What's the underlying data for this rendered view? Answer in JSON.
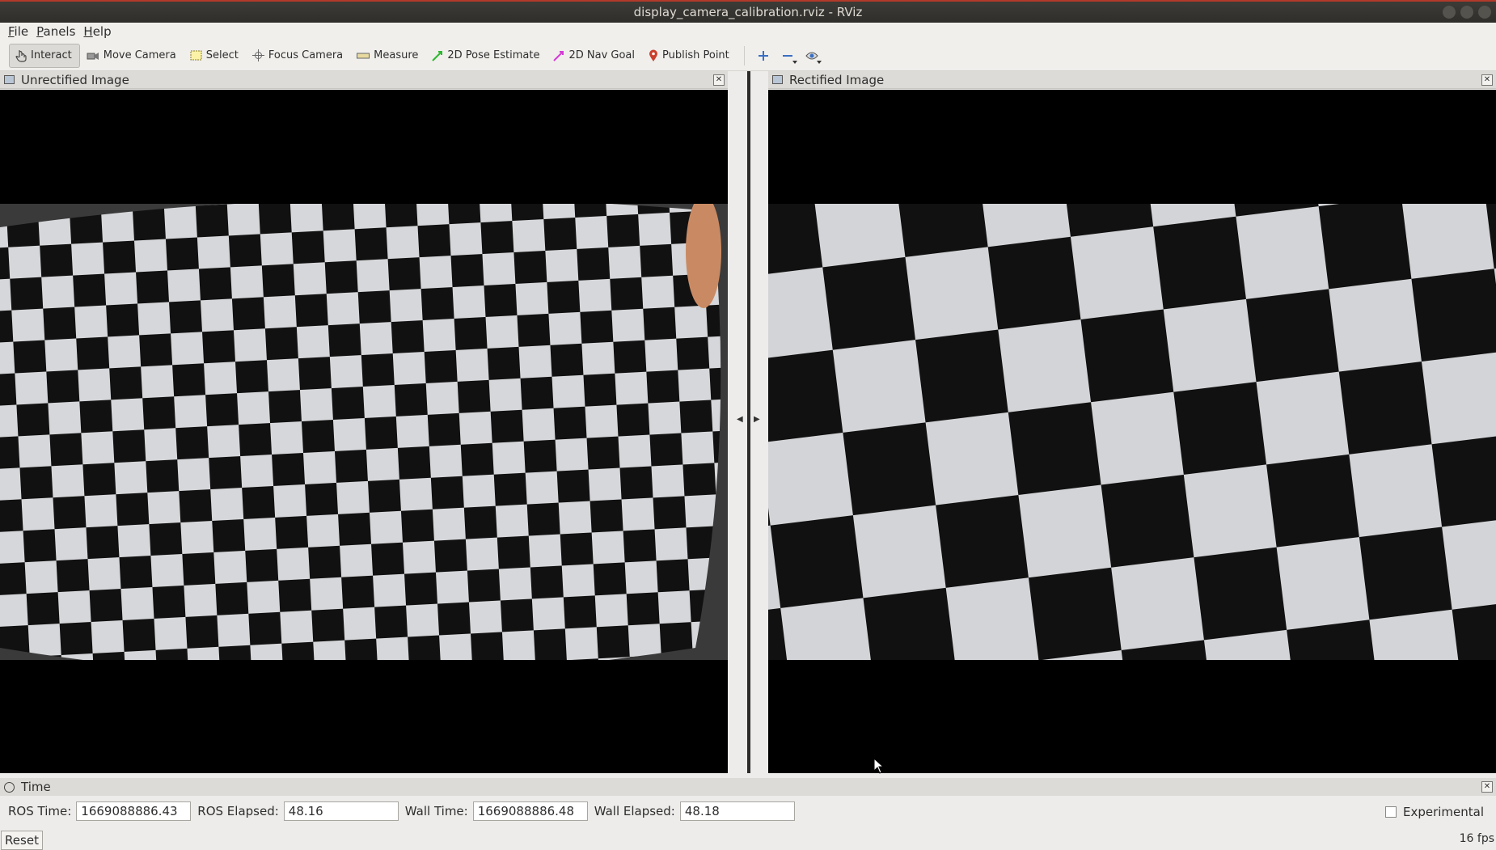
{
  "window": {
    "title": "display_camera_calibration.rviz - RViz"
  },
  "menu": [
    {
      "key": "F",
      "rest": "ile"
    },
    {
      "key": "P",
      "rest": "anels"
    },
    {
      "key": "H",
      "rest": "elp"
    }
  ],
  "toolbar": {
    "interact": "Interact",
    "move_camera": "Move Camera",
    "select": "Select",
    "focus_camera": "Focus Camera",
    "measure": "Measure",
    "pose_estimate": "2D Pose Estimate",
    "nav_goal": "2D Nav Goal",
    "publish_point": "Publish Point"
  },
  "panels": {
    "left_title": "Unrectified Image",
    "right_title": "Rectified Image"
  },
  "time_panel": {
    "title": "Time",
    "ros_time_label": "ROS Time:",
    "ros_time_value": "1669088886.43",
    "ros_elapsed_label": "ROS Elapsed:",
    "ros_elapsed_value": "48.16",
    "wall_time_label": "Wall Time:",
    "wall_time_value": "1669088886.48",
    "wall_elapsed_label": "Wall Elapsed:",
    "wall_elapsed_value": "48.18",
    "experimental_label": "Experimental",
    "experimental_checked": false,
    "reset_label": "Reset",
    "fps": "16 fps"
  }
}
